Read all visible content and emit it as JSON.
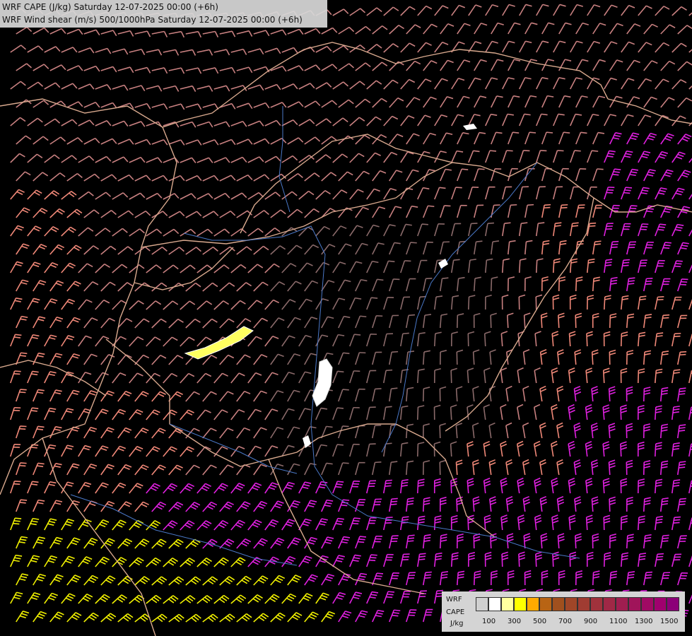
{
  "title": {
    "line1": "WRF CAPE (J/kg) Saturday 12-07-2025 00:00 (+6h)",
    "line2": "WRF Wind shear (m/s) 500/1000hPa Saturday 12-07-2025 00:00 (+6h)"
  },
  "legend": {
    "label_top": "WRF",
    "label_mid": "CAPE",
    "label_unit": "J/kg",
    "colors": [
      "#d0d0d0",
      "#ffffff",
      "#ffffa0",
      "#ffff00",
      "#ffaa00",
      "#b86414",
      "#a0501e",
      "#a04628",
      "#a03c32",
      "#a0323c",
      "#a02846",
      "#a01e50",
      "#a0145a",
      "#a00a64",
      "#a0006e",
      "#8c0078"
    ],
    "ticks": [
      "100",
      "300",
      "500",
      "700",
      "900",
      "1100",
      "1300",
      "1500"
    ]
  },
  "map": {
    "background": "#000000",
    "border_color": "#d9a98e",
    "river_color": "#4a78c8",
    "barb_colors": {
      "weak": "#8a6a6a",
      "moderate": "#c88080",
      "strong": "#f08878",
      "very_strong": "#e020e0",
      "extreme": "#f0f000"
    }
  }
}
